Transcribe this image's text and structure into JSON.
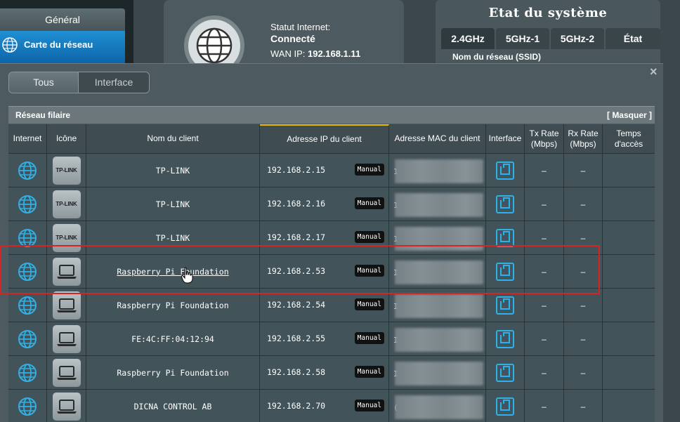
{
  "sidebar": {
    "general": "Général",
    "network_map": "Carte du réseau"
  },
  "internet_status": {
    "label": "Statut Internet:",
    "value": "Connecté",
    "wan_label": "WAN IP:",
    "wan_ip": "192.168.1.11"
  },
  "system_state": {
    "title": "Etat du système",
    "tabs": [
      "2.4GHz",
      "5GHz-1",
      "5GHz-2",
      "État"
    ],
    "ssid_label": "Nom du réseau (SSID)"
  },
  "panel": {
    "close": "×",
    "filter_all": "Tous",
    "filter_interface": "Interface",
    "section_title": "Réseau filaire",
    "hide": "[ Masquer ]",
    "headers": {
      "internet": "Internet",
      "icon": "Icône",
      "client_name": "Nom du client",
      "client_ip": "Adresse IP du client",
      "client_mac": "Adresse MAC du client",
      "interface": "Interface",
      "tx_rate": "Tx Rate (Mbps)",
      "rx_rate": "Rx Rate (Mbps)",
      "access_time": "Temps d'accès"
    },
    "clients": [
      {
        "icon": "tp-link",
        "name": "TP-LINK",
        "ip": "192.168.2.15",
        "mode": "Manual",
        "mac_prefix": "1",
        "tx": "–",
        "rx": "–",
        "time": ""
      },
      {
        "icon": "tp-link",
        "name": "TP-LINK",
        "ip": "192.168.2.16",
        "mode": "Manual",
        "mac_prefix": "1",
        "tx": "–",
        "rx": "–",
        "time": ""
      },
      {
        "icon": "tp-link",
        "name": "TP-LINK",
        "ip": "192.168.2.17",
        "mode": "Manual",
        "mac_prefix": "1",
        "tx": "–",
        "rx": "–",
        "time": ""
      },
      {
        "icon": "laptop",
        "name": "Raspberry Pi Foundation",
        "ip": "192.168.2.53",
        "mode": "Manual",
        "mac_prefix": "I",
        "tx": "–",
        "rx": "–",
        "time": ""
      },
      {
        "icon": "laptop",
        "name": "Raspberry Pi Foundation",
        "ip": "192.168.2.54",
        "mode": "Manual",
        "mac_prefix": "I",
        "tx": "–",
        "rx": "–",
        "time": ""
      },
      {
        "icon": "laptop",
        "name": "FE:4C:FF:04:12:94",
        "ip": "192.168.2.55",
        "mode": "Manual",
        "mac_prefix": "I",
        "tx": "–",
        "rx": "–",
        "time": ""
      },
      {
        "icon": "laptop",
        "name": "Raspberry Pi Foundation",
        "ip": "192.168.2.58",
        "mode": "Manual",
        "mac_prefix": "I",
        "tx": "–",
        "rx": "–",
        "time": ""
      },
      {
        "icon": "laptop",
        "name": "DICNA CONTROL AB",
        "ip": "192.168.2.70",
        "mode": "Manual",
        "mac_prefix": "(",
        "tx": "–",
        "rx": "–",
        "time": ""
      }
    ],
    "tp_link_logo": "TP-LINK",
    "accent_color": "#2fb0e8",
    "highlight_color": "#d42424"
  }
}
